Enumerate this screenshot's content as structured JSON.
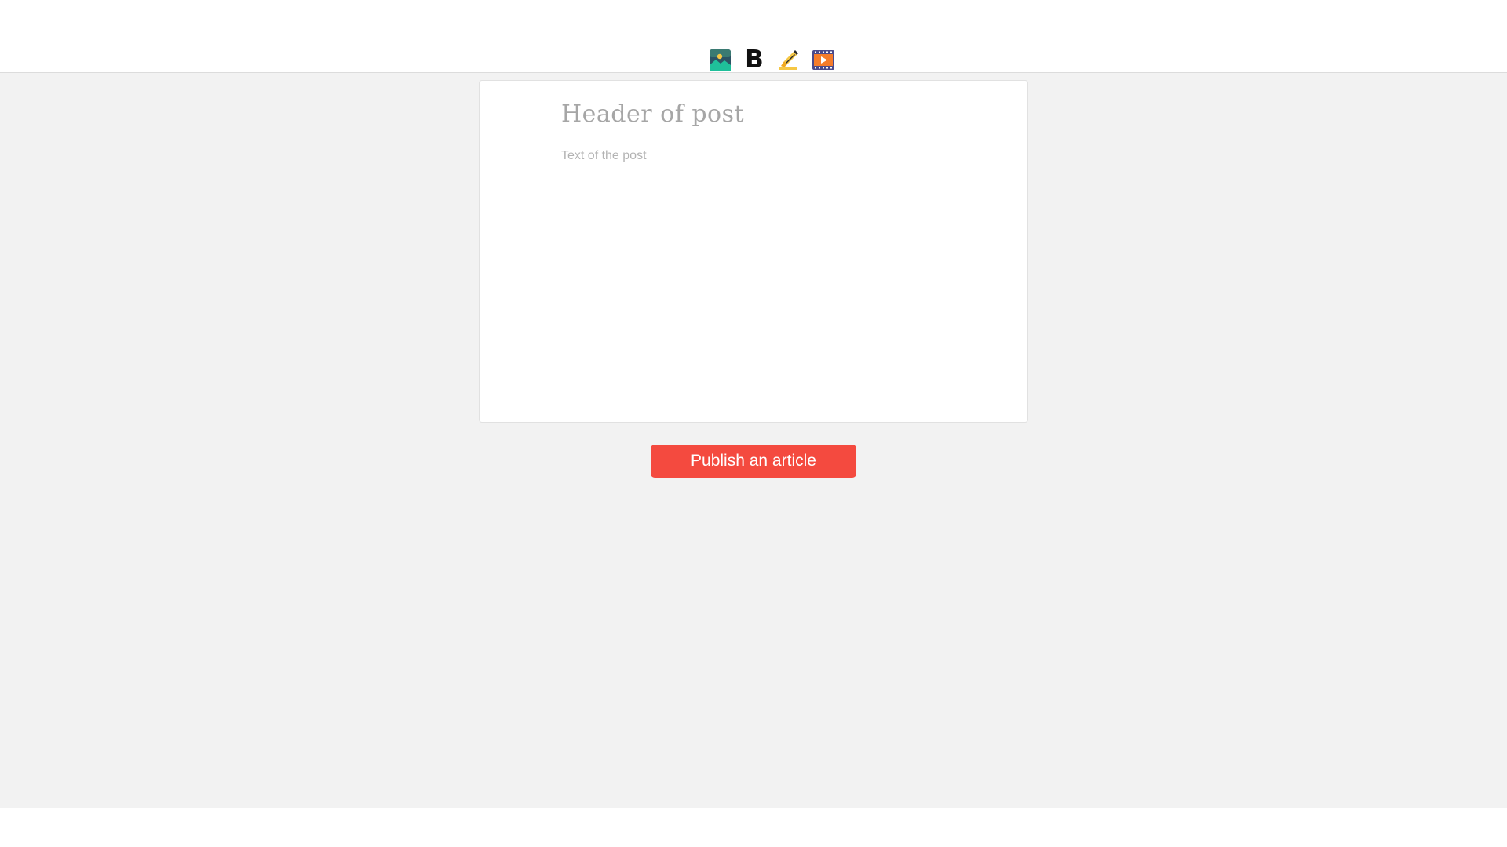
{
  "toolbar": {
    "tools": [
      {
        "icon": "image-icon"
      },
      {
        "icon": "bold-icon",
        "glyph": "B"
      },
      {
        "icon": "highlighter-icon"
      },
      {
        "icon": "video-icon"
      }
    ]
  },
  "editor": {
    "title_placeholder": "Header of post",
    "text_placeholder": "Text of the post"
  },
  "actions": {
    "publish_label": "Publish an article"
  },
  "colors": {
    "accent": "#f44a3f",
    "background": "#f2f2f2",
    "card": "#ffffff"
  }
}
